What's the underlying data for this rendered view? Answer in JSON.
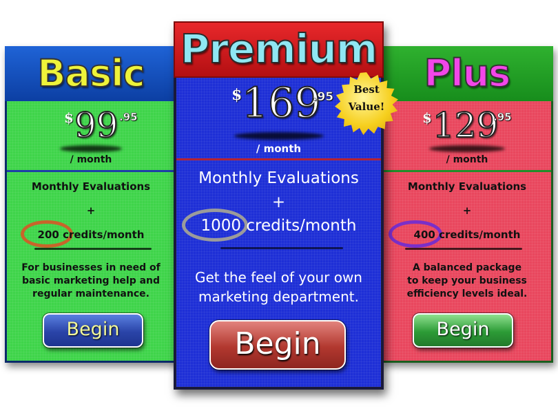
{
  "colors": {
    "basic_body": "#3fd44a",
    "basic_header": "#1f63d6",
    "premium_body": "#1e2fd6",
    "premium_header": "#e8282b",
    "plus_body": "#e9475e",
    "plus_header": "#2fb12f",
    "basic_title": "#eef33a",
    "premium_title": "#8fe7f3",
    "plus_title": "#f246e8",
    "badge": "#f6cf1d"
  },
  "basic": {
    "title": "Basic",
    "currency": "$",
    "price": "99",
    "cents": ".95",
    "period": "/ month",
    "feature": "Monthly Evaluations",
    "plus_sign": "+",
    "credits": "200 credits/month",
    "description_lines": [
      "For businesses in need of",
      "basic marketing help and",
      "regular maintenance."
    ],
    "button_label": "Begin"
  },
  "premium": {
    "title": "Premium",
    "currency": "$",
    "price": "169",
    "cents": ".95",
    "period": "/ month",
    "feature": "Monthly Evaluations",
    "plus_sign": "+",
    "credits": "1000 credits/month",
    "description_lines": [
      "Get the feel of your own",
      "marketing department."
    ],
    "button_label": "Begin",
    "badge_lines": [
      "Best",
      "Value!"
    ]
  },
  "plus": {
    "title": "Plus",
    "currency": "$",
    "price": "129",
    "cents": ".95",
    "period": "/ month",
    "feature": "Monthly Evaluations",
    "plus_sign": "+",
    "credits": "400 credits/month",
    "description_lines": [
      "A balanced package",
      "to keep your business",
      "efficiency levels ideal."
    ],
    "button_label": "Begin"
  }
}
